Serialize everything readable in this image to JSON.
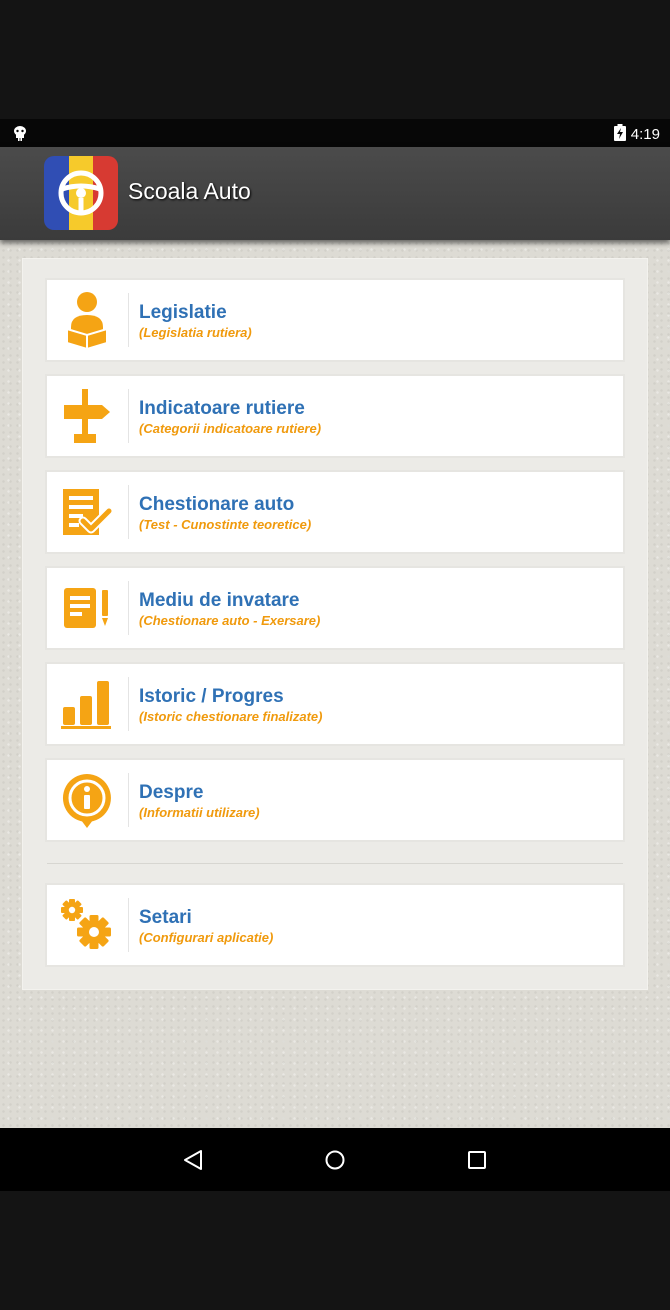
{
  "status_bar": {
    "time": "4:19",
    "icons": [
      "android-debug-icon",
      "battery-charging-icon"
    ]
  },
  "action_bar": {
    "title": "Scoala Auto",
    "logo_icon": "steering-wheel-romanian-flag-logo"
  },
  "menu": {
    "items": [
      {
        "title": "Legislatie",
        "subtitle": "(Legislatia rutiera)",
        "icon": "person-reading-book-icon"
      },
      {
        "title": "Indicatoare rutiere",
        "subtitle": "(Categorii indicatoare rutiere)",
        "icon": "road-signpost-icon"
      },
      {
        "title": "Chestionare auto",
        "subtitle": "(Test - Cunostinte teoretice)",
        "icon": "checklist-icon"
      },
      {
        "title": "Mediu de invatare",
        "subtitle": "(Chestionare auto - Exersare)",
        "icon": "document-exclamation-icon"
      },
      {
        "title": "Istoric / Progres",
        "subtitle": "(Istoric chestionare finalizate)",
        "icon": "bar-chart-icon"
      },
      {
        "title": "Despre",
        "subtitle": "(Informatii utilizare)",
        "icon": "info-icon"
      }
    ],
    "settings": {
      "title": "Setari",
      "subtitle": "(Configurari aplicatie)",
      "icon": "gears-icon"
    }
  },
  "nav_bar": {
    "buttons": [
      "back-icon",
      "home-icon",
      "recents-icon"
    ]
  },
  "colors": {
    "title_blue": "#2f71b5",
    "accent_orange": "#f09a0d",
    "action_bar": "#444444"
  }
}
